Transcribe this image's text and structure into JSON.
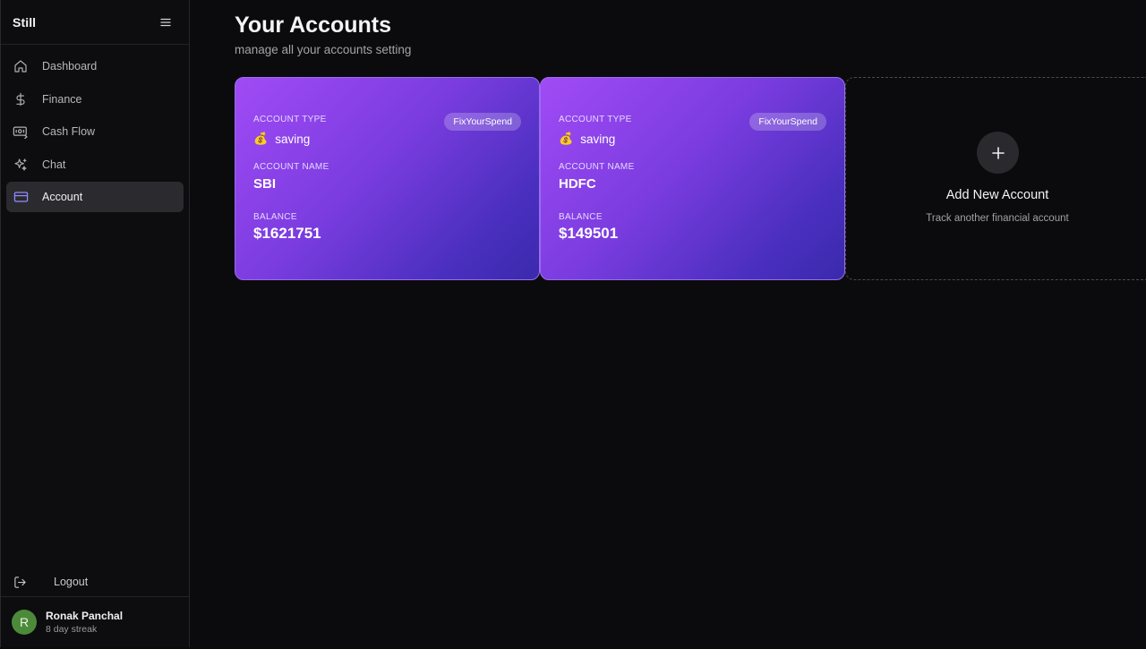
{
  "app": {
    "name": "Still"
  },
  "sidebar": {
    "items": [
      {
        "label": "Dashboard",
        "icon": "home-icon",
        "active": false
      },
      {
        "label": "Finance",
        "icon": "dollar-icon",
        "active": false
      },
      {
        "label": "Cash Flow",
        "icon": "cash-flow-icon",
        "active": false
      },
      {
        "label": "Chat",
        "icon": "sparkles-icon",
        "active": false
      },
      {
        "label": "Account",
        "icon": "credit-card-icon",
        "active": true
      }
    ],
    "logout_label": "Logout",
    "user": {
      "initial": "R",
      "name": "Ronak Panchal",
      "streak": "8 day streak"
    }
  },
  "main": {
    "title": "Your Accounts",
    "subtitle": "manage all your accounts setting",
    "labels": {
      "type": "Account Type",
      "name": "Account Name",
      "balance": "Balance"
    },
    "accounts": [
      {
        "badge": "FixYourSpend",
        "type_emoji": "💰",
        "type": "saving",
        "name": "SBI",
        "balance": "$1621751"
      },
      {
        "badge": "FixYourSpend",
        "type_emoji": "💰",
        "type": "saving",
        "name": "HDFC",
        "balance": "$149501"
      }
    ],
    "add_card": {
      "title": "Add New Account",
      "subtitle": "Track another financial account"
    }
  },
  "colors": {
    "background": "#0b0b0d",
    "sidebar": "#0d0d10",
    "card_gradient_start": "#a14bf5",
    "card_gradient_end": "#3a2aac",
    "active_item": "#2b2b2f",
    "avatar": "#4c8a3a"
  }
}
